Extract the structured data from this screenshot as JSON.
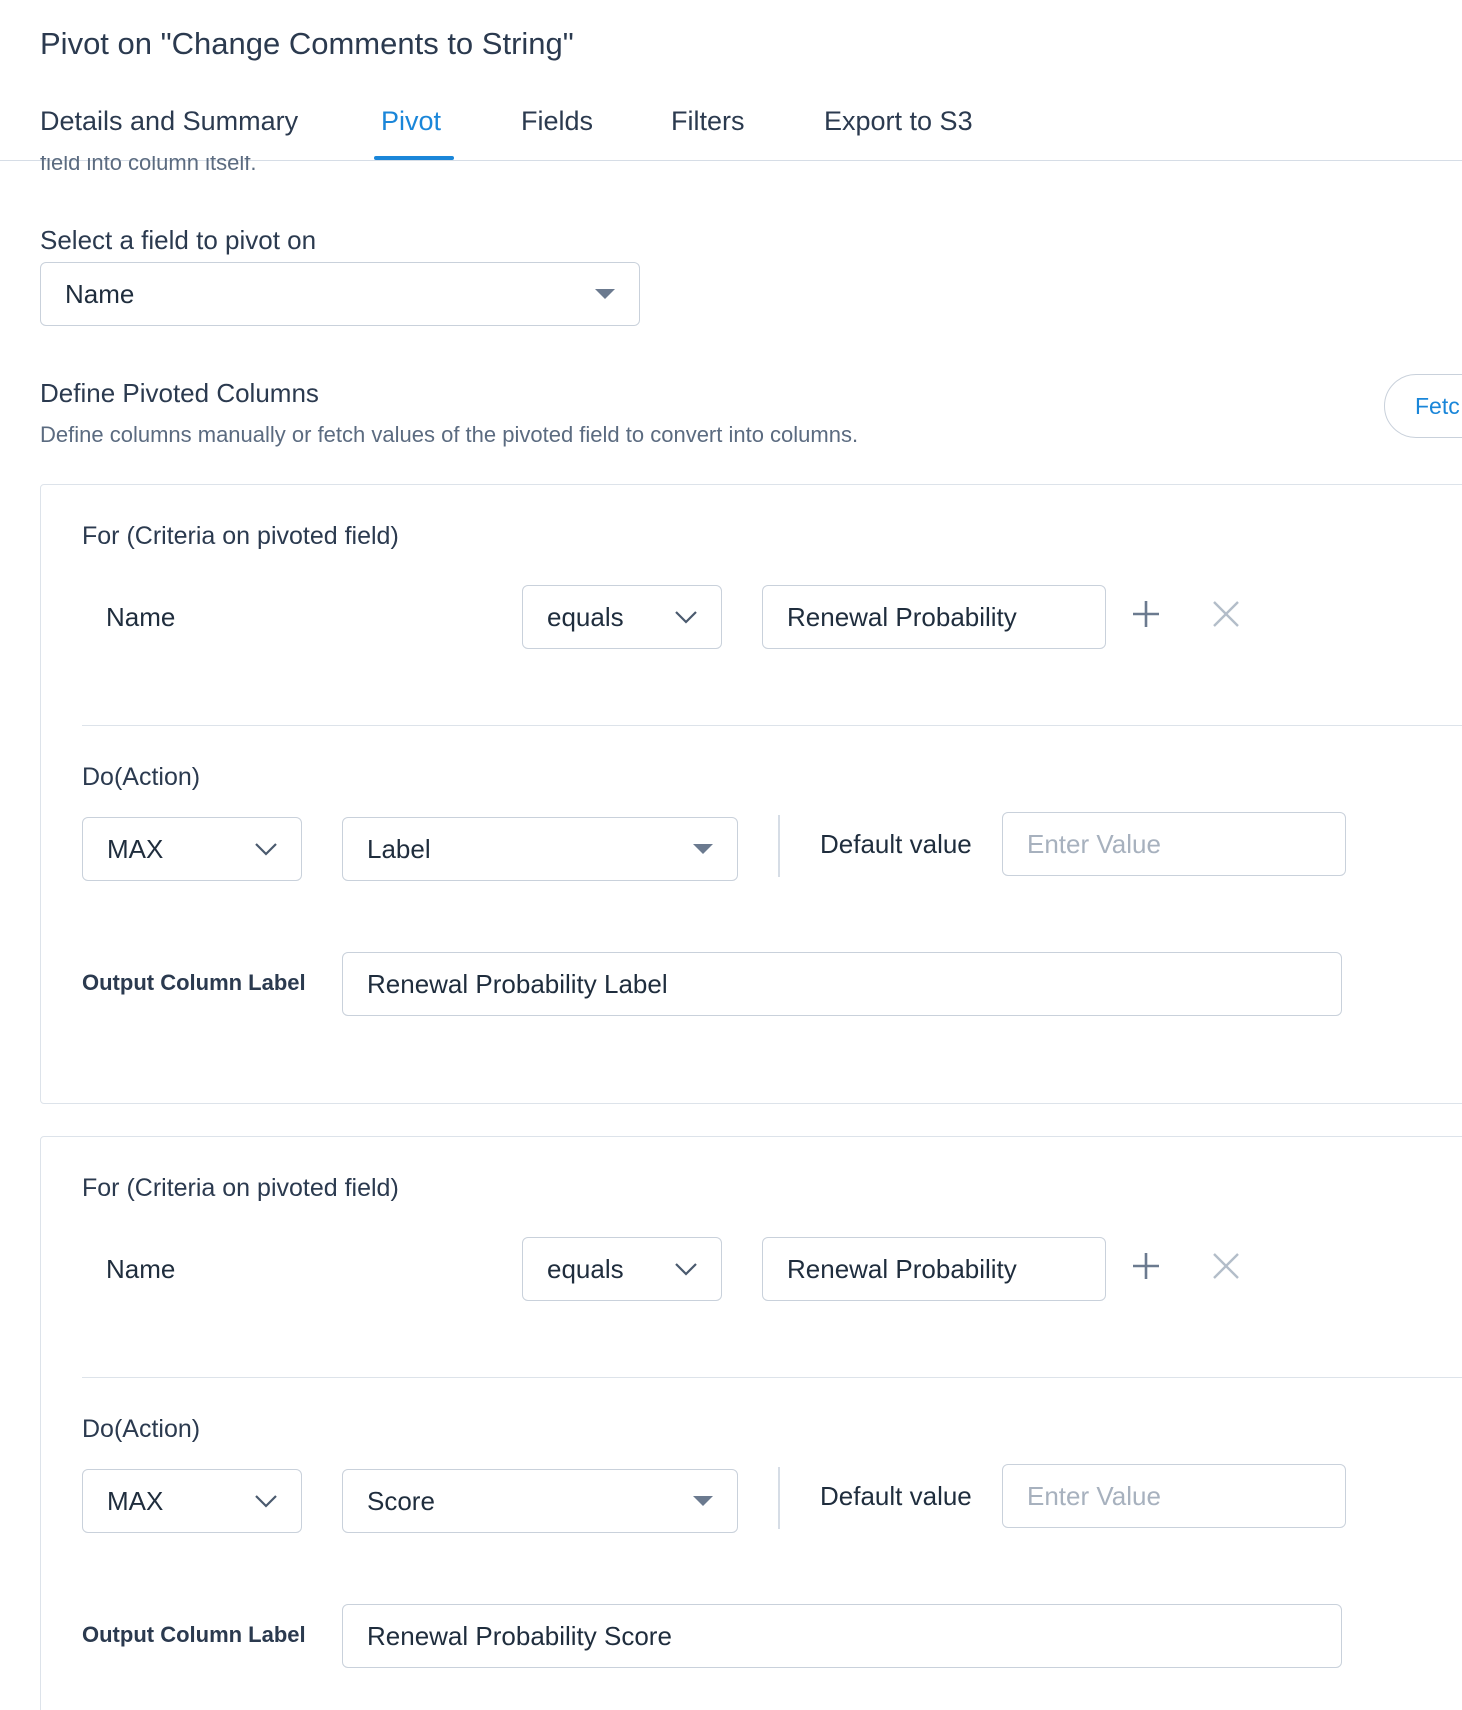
{
  "header": {
    "title": "Pivot on \"Change Comments to String\""
  },
  "tabs": [
    {
      "label": "Details and Summary",
      "active": false
    },
    {
      "label": "Pivot",
      "active": true
    },
    {
      "label": "Fields",
      "active": false
    },
    {
      "label": "Filters",
      "active": false
    },
    {
      "label": "Export to S3",
      "active": false
    }
  ],
  "pivot": {
    "clipped_help_text": "field into column itself.",
    "select_field_label": "Select a field to pivot on",
    "select_field_value": "Name",
    "define_title": "Define Pivoted Columns",
    "define_description": "Define columns manually or fetch values of the pivoted field to convert into columns.",
    "fetch_button_label": "Fetc"
  },
  "accent_color": "#1a86d9",
  "cards": [
    {
      "criteria_title": "For (Criteria on pivoted field)",
      "criteria_field": "Name",
      "criteria_operator": "equals",
      "criteria_value": "Renewal Probability",
      "action_title": "Do(Action)",
      "aggregate": "MAX",
      "action_field": "Label",
      "default_value_label": "Default value",
      "default_value_placeholder": "Enter Value",
      "output_label": "Output Column Label",
      "output_value": "Renewal Probability Label"
    },
    {
      "criteria_title": "For (Criteria on pivoted field)",
      "criteria_field": "Name",
      "criteria_operator": "equals",
      "criteria_value": "Renewal Probability",
      "action_title": "Do(Action)",
      "aggregate": "MAX",
      "action_field": "Score",
      "default_value_label": "Default value",
      "default_value_placeholder": "Enter Value",
      "output_label": "Output Column Label",
      "output_value": "Renewal Probability Score"
    }
  ]
}
